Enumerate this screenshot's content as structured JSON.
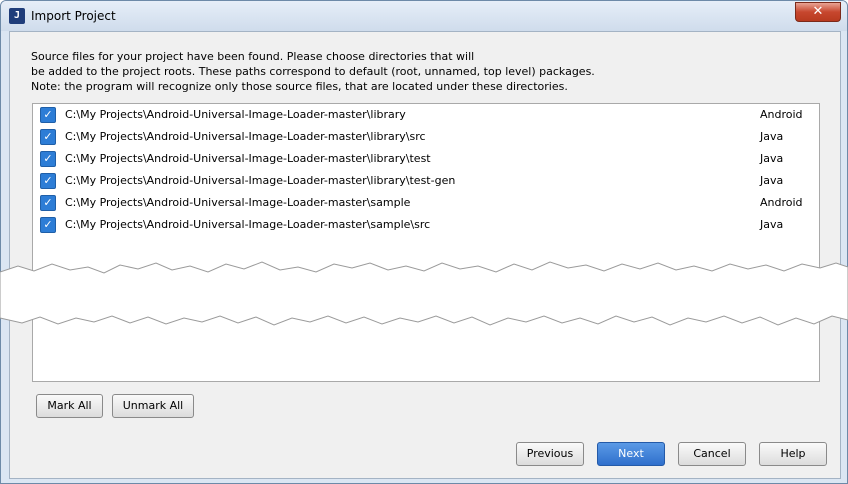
{
  "window": {
    "title": "Import Project",
    "app_icon_glyph": "J",
    "close_glyph": "✕"
  },
  "description": {
    "line1": "Source files for your project have been found. Please choose directories that will",
    "line2": "be added to the project roots. These paths correspond to default (root, unnamed, top level) packages.",
    "line3": "Note: the program will recognize only those source files, that are located under these directories."
  },
  "directories": [
    {
      "path": "C:\\My Projects\\Android-Universal-Image-Loader-master\\library",
      "type": "Android",
      "checked": true
    },
    {
      "path": "C:\\My Projects\\Android-Universal-Image-Loader-master\\library\\src",
      "type": "Java",
      "checked": true
    },
    {
      "path": "C:\\My Projects\\Android-Universal-Image-Loader-master\\library\\test",
      "type": "Java",
      "checked": true
    },
    {
      "path": "C:\\My Projects\\Android-Universal-Image-Loader-master\\library\\test-gen",
      "type": "Java",
      "checked": true
    },
    {
      "path": "C:\\My Projects\\Android-Universal-Image-Loader-master\\sample",
      "type": "Android",
      "checked": true
    },
    {
      "path": "C:\\My Projects\\Android-Universal-Image-Loader-master\\sample\\src",
      "type": "Java",
      "checked": true
    }
  ],
  "checkbox_glyph": "✓",
  "buttons": {
    "mark_all": "Mark All",
    "unmark_all": "Unmark All",
    "previous": "Previous",
    "next": "Next",
    "cancel": "Cancel",
    "help": "Help"
  },
  "colors": {
    "accent": "#2f6fcc",
    "checkbox": "#2d7dd6"
  }
}
